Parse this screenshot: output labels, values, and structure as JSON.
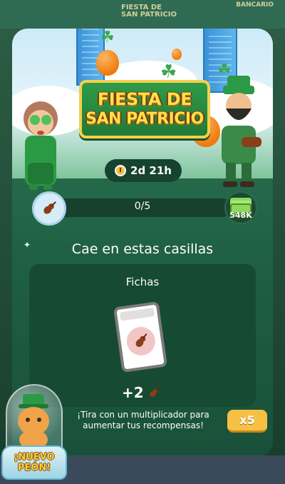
{
  "board": {
    "top_label": "FIESTA DE\nSAN PATRICIO",
    "top_right_label": "BANCARIO"
  },
  "event": {
    "title_line1": "FIESTA DE",
    "title_line2": "SAN PATRICIO",
    "timer": "2d 21h"
  },
  "progress": {
    "text": "0/5",
    "current": 0,
    "total": 5,
    "reward_amount": "548K",
    "item_icon": "violin-icon",
    "reward_icon": "cash-stack-icon"
  },
  "heading": "Cae en estas casillas",
  "card": {
    "title": "Fichas",
    "count": "+2",
    "ticket_icon": "violin-icon"
  },
  "footer": {
    "text": "¡Tira con un multiplicador para aumentar tus recompensas!",
    "multiplier": "x5"
  },
  "pawn": {
    "line1": "¡NUEVO",
    "line2": "PEÓN!"
  },
  "colors": {
    "panel_green": "#2f7b58",
    "card_bg": "#174a33",
    "banner_gold": "#ffe14a",
    "multiplier_button": "#f5c044"
  }
}
